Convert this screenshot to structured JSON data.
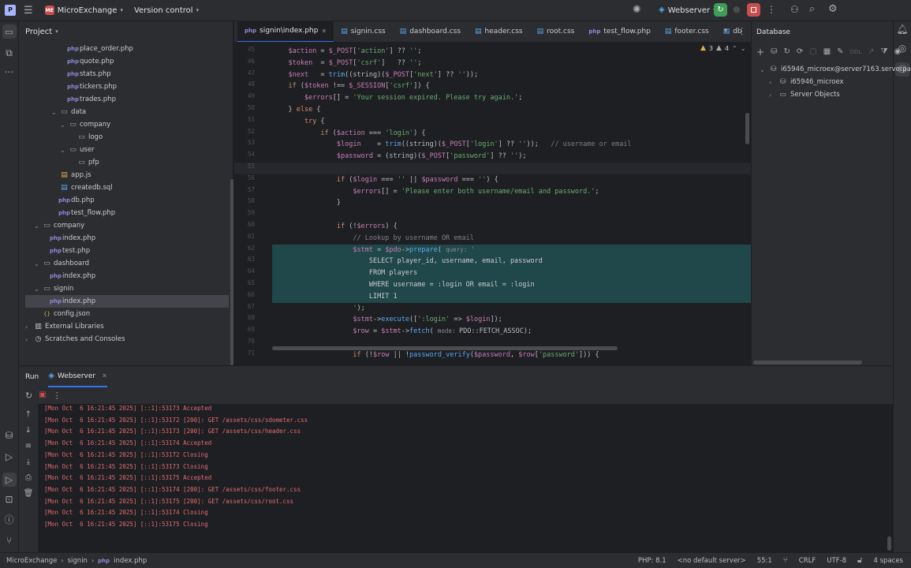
{
  "titlebar": {
    "project_badge": "ME",
    "project_name": "MicroExchange",
    "vcs_label": "Version control",
    "run_config": "Webserver"
  },
  "project_panel": {
    "title": "Project",
    "tree": [
      {
        "label": "place_order.php",
        "type": "php",
        "depth": 4
      },
      {
        "label": "quote.php",
        "type": "php",
        "depth": 4
      },
      {
        "label": "stats.php",
        "type": "php",
        "depth": 4
      },
      {
        "label": "tickers.php",
        "type": "php",
        "depth": 4
      },
      {
        "label": "trades.php",
        "type": "php",
        "depth": 4
      },
      {
        "label": "data",
        "type": "folder",
        "depth": 3,
        "open": true
      },
      {
        "label": "company",
        "type": "folder",
        "depth": 4,
        "open": true
      },
      {
        "label": "logo",
        "type": "folder",
        "depth": 5
      },
      {
        "label": "user",
        "type": "folder",
        "depth": 4,
        "open": true
      },
      {
        "label": "pfp",
        "type": "folder",
        "depth": 5
      },
      {
        "label": "app.js",
        "type": "js",
        "depth": 3
      },
      {
        "label": "createdb.sql",
        "type": "sql",
        "depth": 3
      },
      {
        "label": "db.php",
        "type": "php",
        "depth": 3
      },
      {
        "label": "test_flow.php",
        "type": "php",
        "depth": 3
      },
      {
        "label": "company",
        "type": "folder",
        "depth": 1,
        "open": true
      },
      {
        "label": "index.php",
        "type": "php",
        "depth": 2
      },
      {
        "label": "test.php",
        "type": "php",
        "depth": 2
      },
      {
        "label": "dashboard",
        "type": "folder",
        "depth": 1,
        "open": true
      },
      {
        "label": "index.php",
        "type": "php",
        "depth": 2
      },
      {
        "label": "signin",
        "type": "folder",
        "depth": 1,
        "open": true
      },
      {
        "label": "index.php",
        "type": "php",
        "depth": 2,
        "selected": true
      },
      {
        "label": "config.json",
        "type": "json",
        "depth": 1
      },
      {
        "label": "External Libraries",
        "type": "lib",
        "depth": 0,
        "closed": true
      },
      {
        "label": "Scratches and Consoles",
        "type": "scratch",
        "depth": 0,
        "closed": true
      }
    ]
  },
  "editor": {
    "tabs": [
      {
        "label": "signin\\index.php",
        "active": true,
        "closable": true
      },
      {
        "label": "signin.css",
        "active": false,
        "closable": false
      },
      {
        "label": "dashboard.css",
        "active": false,
        "closable": false
      },
      {
        "label": "header.css",
        "active": false,
        "closable": false
      },
      {
        "label": "root.css",
        "active": false,
        "closable": false
      },
      {
        "label": "test_flow.php",
        "active": false,
        "closable": false
      },
      {
        "label": "footer.css",
        "active": false,
        "closable": false
      },
      {
        "label": "db",
        "active": false,
        "closable": false
      }
    ],
    "warnings_count": "3",
    "weak_warnings_count": "4",
    "line_numbers": [
      "45",
      "46",
      "47",
      "48",
      "49",
      "50",
      "51",
      "52",
      "53",
      "54",
      "55",
      "56",
      "57",
      "58",
      "59",
      "60",
      "61",
      "62",
      "63",
      "64",
      "65",
      "66",
      "67",
      "68",
      "69",
      "70",
      "71"
    ],
    "highlighted_lines": [
      17,
      18,
      19,
      20,
      21
    ],
    "current_line": 10,
    "code": [
      [
        [
          "    ",
          ""
        ],
        [
          "$action",
          "v"
        ],
        [
          " = ",
          ""
        ],
        [
          "$_POST",
          "v"
        ],
        [
          "[",
          ""
        ],
        [
          "'action'",
          "s"
        ],
        [
          "] ?? ",
          ""
        ],
        [
          "''",
          "s"
        ],
        [
          ";",
          ""
        ]
      ],
      [
        [
          "    ",
          ""
        ],
        [
          "$token",
          "v"
        ],
        [
          "  = ",
          ""
        ],
        [
          "$_POST",
          "v"
        ],
        [
          "[",
          ""
        ],
        [
          "'csrf'",
          "s"
        ],
        [
          "]   ?? ",
          ""
        ],
        [
          "''",
          "s"
        ],
        [
          ";",
          ""
        ]
      ],
      [
        [
          "    ",
          ""
        ],
        [
          "$next",
          "v"
        ],
        [
          "   = ",
          ""
        ],
        [
          "trim",
          "f"
        ],
        [
          "((string)(",
          ""
        ],
        [
          "$_POST",
          "v"
        ],
        [
          "[",
          ""
        ],
        [
          "'next'",
          "s"
        ],
        [
          "] ?? ",
          ""
        ],
        [
          "''",
          "s"
        ],
        [
          "));",
          ""
        ]
      ],
      [
        [
          "    ",
          ""
        ],
        [
          "if",
          "k"
        ],
        [
          " (",
          ""
        ],
        [
          "$token",
          "v"
        ],
        [
          " !== ",
          ""
        ],
        [
          "$_SESSION",
          "v"
        ],
        [
          "[",
          ""
        ],
        [
          "'csrf'",
          "s"
        ],
        [
          "]) {",
          ""
        ]
      ],
      [
        [
          "        ",
          ""
        ],
        [
          "$errors",
          "v"
        ],
        [
          "[] = ",
          ""
        ],
        [
          "'Your session expired. Please try again.'",
          "s"
        ],
        [
          ";",
          ""
        ]
      ],
      [
        [
          "    } ",
          ""
        ],
        [
          "else",
          "k"
        ],
        [
          " {",
          ""
        ]
      ],
      [
        [
          "        ",
          ""
        ],
        [
          "try",
          "k"
        ],
        [
          " {",
          ""
        ]
      ],
      [
        [
          "            ",
          ""
        ],
        [
          "if",
          "k"
        ],
        [
          " (",
          ""
        ],
        [
          "$action",
          "v"
        ],
        [
          " === ",
          ""
        ],
        [
          "'login'",
          "s"
        ],
        [
          ") {",
          ""
        ]
      ],
      [
        [
          "                ",
          ""
        ],
        [
          "$login",
          "v"
        ],
        [
          "    = ",
          ""
        ],
        [
          "trim",
          "f"
        ],
        [
          "((string)(",
          ""
        ],
        [
          "$_POST",
          "v"
        ],
        [
          "[",
          ""
        ],
        [
          "'login'",
          "s"
        ],
        [
          "] ?? ",
          ""
        ],
        [
          "''",
          "s"
        ],
        [
          "));   ",
          ""
        ],
        [
          "// username or email",
          "c"
        ]
      ],
      [
        [
          "                ",
          ""
        ],
        [
          "$password",
          "v"
        ],
        [
          " = (string)(",
          ""
        ],
        [
          "$_POST",
          "v"
        ],
        [
          "[",
          ""
        ],
        [
          "'password'",
          "s"
        ],
        [
          "] ?? ",
          ""
        ],
        [
          "''",
          "s"
        ],
        [
          ");",
          ""
        ]
      ],
      [
        [
          "",
          ""
        ]
      ],
      [
        [
          "                ",
          ""
        ],
        [
          "if",
          "k"
        ],
        [
          " (",
          ""
        ],
        [
          "$login",
          "v"
        ],
        [
          " === ",
          ""
        ],
        [
          "''",
          "s"
        ],
        [
          " || ",
          ""
        ],
        [
          "$password",
          "v"
        ],
        [
          " === ",
          ""
        ],
        [
          "''",
          "s"
        ],
        [
          ") {",
          ""
        ]
      ],
      [
        [
          "                    ",
          ""
        ],
        [
          "$errors",
          "v"
        ],
        [
          "[] = ",
          ""
        ],
        [
          "'Please enter both username/email and password.'",
          "s"
        ],
        [
          ";",
          ""
        ]
      ],
      [
        [
          "                }",
          ""
        ]
      ],
      [
        [
          "",
          ""
        ]
      ],
      [
        [
          "                ",
          ""
        ],
        [
          "if",
          "k"
        ],
        [
          " (!",
          ""
        ],
        [
          "$errors",
          "v"
        ],
        [
          ") {",
          ""
        ]
      ],
      [
        [
          "                    ",
          ""
        ],
        [
          "// Lookup by username OR email",
          "c"
        ]
      ],
      [
        [
          "                    ",
          ""
        ],
        [
          "$stmt",
          "v"
        ],
        [
          " = ",
          ""
        ],
        [
          "$pdo",
          "v"
        ],
        [
          "->",
          ""
        ],
        [
          "prepare",
          "f"
        ],
        [
          "( ",
          ""
        ],
        [
          "query: ",
          "h"
        ],
        [
          "'",
          "s"
        ]
      ],
      [
        [
          "                        ",
          ""
        ],
        [
          "SELECT player_id, username, email, password",
          "sq"
        ]
      ],
      [
        [
          "                        ",
          ""
        ],
        [
          "FROM players",
          "sq"
        ]
      ],
      [
        [
          "                        ",
          ""
        ],
        [
          "WHERE username = :login OR email = :login",
          "sq"
        ]
      ],
      [
        [
          "                        ",
          ""
        ],
        [
          "LIMIT 1",
          "sq"
        ]
      ],
      [
        [
          "                    ",
          ""
        ],
        [
          "'",
          "s"
        ],
        [
          ");",
          ""
        ]
      ],
      [
        [
          "                    ",
          ""
        ],
        [
          "$stmt",
          "v"
        ],
        [
          "->",
          ""
        ],
        [
          "execute",
          "f"
        ],
        [
          "([",
          ""
        ],
        [
          "':login'",
          "s"
        ],
        [
          " => ",
          ""
        ],
        [
          "$login",
          "v"
        ],
        [
          "]);",
          ""
        ]
      ],
      [
        [
          "                    ",
          ""
        ],
        [
          "$row",
          "v"
        ],
        [
          " = ",
          ""
        ],
        [
          "$stmt",
          "v"
        ],
        [
          "->",
          ""
        ],
        [
          "fetch",
          "f"
        ],
        [
          "( ",
          ""
        ],
        [
          "mode: ",
          "h"
        ],
        [
          "PDO::FETCH_ASSOC",
          ""
        ],
        [
          ");",
          ""
        ]
      ],
      [
        [
          "",
          ""
        ]
      ],
      [
        [
          "                    ",
          ""
        ],
        [
          "if",
          "k"
        ],
        [
          " (!",
          ""
        ],
        [
          "$row",
          "v"
        ],
        [
          " || !",
          ""
        ],
        [
          "password_verify",
          "f"
        ],
        [
          "(",
          ""
        ],
        [
          "$password",
          "v"
        ],
        [
          ", ",
          ""
        ],
        [
          "$row",
          "v"
        ],
        [
          "[",
          ""
        ],
        [
          "'password'",
          "s"
        ],
        [
          "])) {",
          ""
        ]
      ]
    ]
  },
  "database_panel": {
    "title": "Database",
    "tree": [
      {
        "label": "i65946_microex@server7163.serverpar",
        "depth": 0,
        "open": true
      },
      {
        "label": "i65946_microex",
        "depth": 1
      },
      {
        "label": "Server Objects",
        "depth": 1
      }
    ]
  },
  "run_panel": {
    "title": "Run",
    "tab_label": "Webserver",
    "logs": [
      "[Mon Oct  6 16:21:45 2025] [::1]:53173 Accepted",
      "[Mon Oct  6 16:21:45 2025] [::1]:53172 [200]: GET /assets/css/sdometer.css",
      "[Mon Oct  6 16:21:45 2025] [::1]:53173 [200]: GET /assets/css/header.css",
      "[Mon Oct  6 16:21:45 2025] [::1]:53174 Accepted",
      "[Mon Oct  6 16:21:45 2025] [::1]:53172 Closing",
      "[Mon Oct  6 16:21:45 2025] [::1]:53173 Closing",
      "[Mon Oct  6 16:21:45 2025] [::1]:53175 Accepted",
      "[Mon Oct  6 16:21:45 2025] [::1]:53174 [200]: GET /assets/css/footer.css",
      "[Mon Oct  6 16:21:45 2025] [::1]:53175 [200]: GET /assets/css/root.css",
      "[Mon Oct  6 16:21:45 2025] [::1]:53174 Closing",
      "[Mon Oct  6 16:21:45 2025] [::1]:53175 Closing"
    ]
  },
  "statusbar": {
    "breadcrumb": [
      "MicroExchange",
      "signin",
      "index.php"
    ],
    "php_version": "PHP: 8.1",
    "server": "<no default server>",
    "position": "55:1",
    "line_sep": "CRLF",
    "encoding": "UTF-8",
    "indent": "4 spaces"
  },
  "colors": {
    "accent": "#3574f0",
    "run_green": "#3f9c57",
    "stop_red": "#c94f4f",
    "log_red": "#e06c75"
  }
}
